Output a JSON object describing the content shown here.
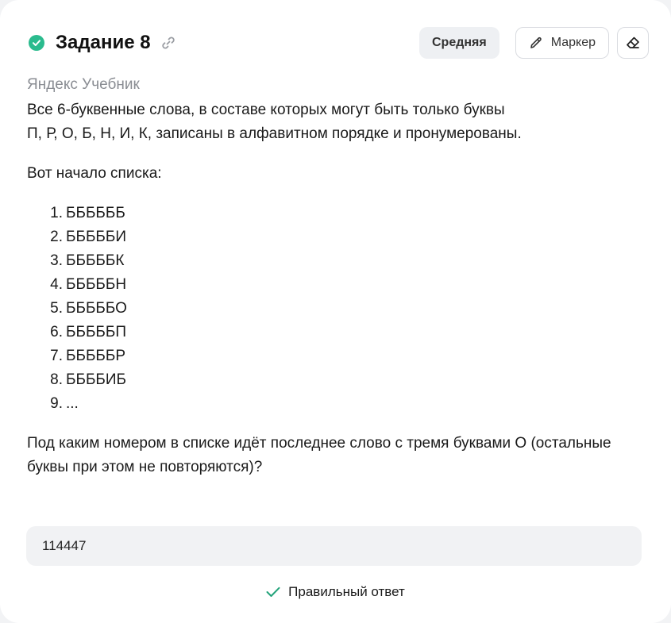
{
  "task": {
    "title": "Задание 8",
    "difficulty": "Средняя",
    "marker_label": "Маркер",
    "source": "Яндекс Учебник"
  },
  "body": {
    "intro_line1": "Все 6-буквенные слова, в составе которых могут быть только буквы",
    "intro_line2": "П, Р, О, Б, Н, И, К, записаны в алфавитном порядке и пронумерованы.",
    "list_intro": "Вот начало списка:",
    "list": [
      {
        "num": "1.",
        "text": "ББББББ"
      },
      {
        "num": "2.",
        "text": "БББББИ"
      },
      {
        "num": "3.",
        "text": "БББББК"
      },
      {
        "num": "4.",
        "text": "БББББН"
      },
      {
        "num": "5.",
        "text": "БББББО"
      },
      {
        "num": "6.",
        "text": "БББББП"
      },
      {
        "num": "7.",
        "text": "БББББР"
      },
      {
        "num": "8.",
        "text": "ББББИБ"
      },
      {
        "num": "9.",
        "text": "..."
      }
    ],
    "question_line1": "Под каким номером в списке идёт последнее слово с тремя буквами О (остальные",
    "question_line2": "буквы при этом не повторяются)?"
  },
  "answer": {
    "value": "114447",
    "result_text": "Правильный ответ"
  },
  "colors": {
    "success": "#2bbb8e",
    "check": "#22a37a"
  },
  "icons": [
    "check-circle-icon",
    "link-icon",
    "pencil-icon",
    "eraser-icon",
    "checkmark-icon"
  ]
}
